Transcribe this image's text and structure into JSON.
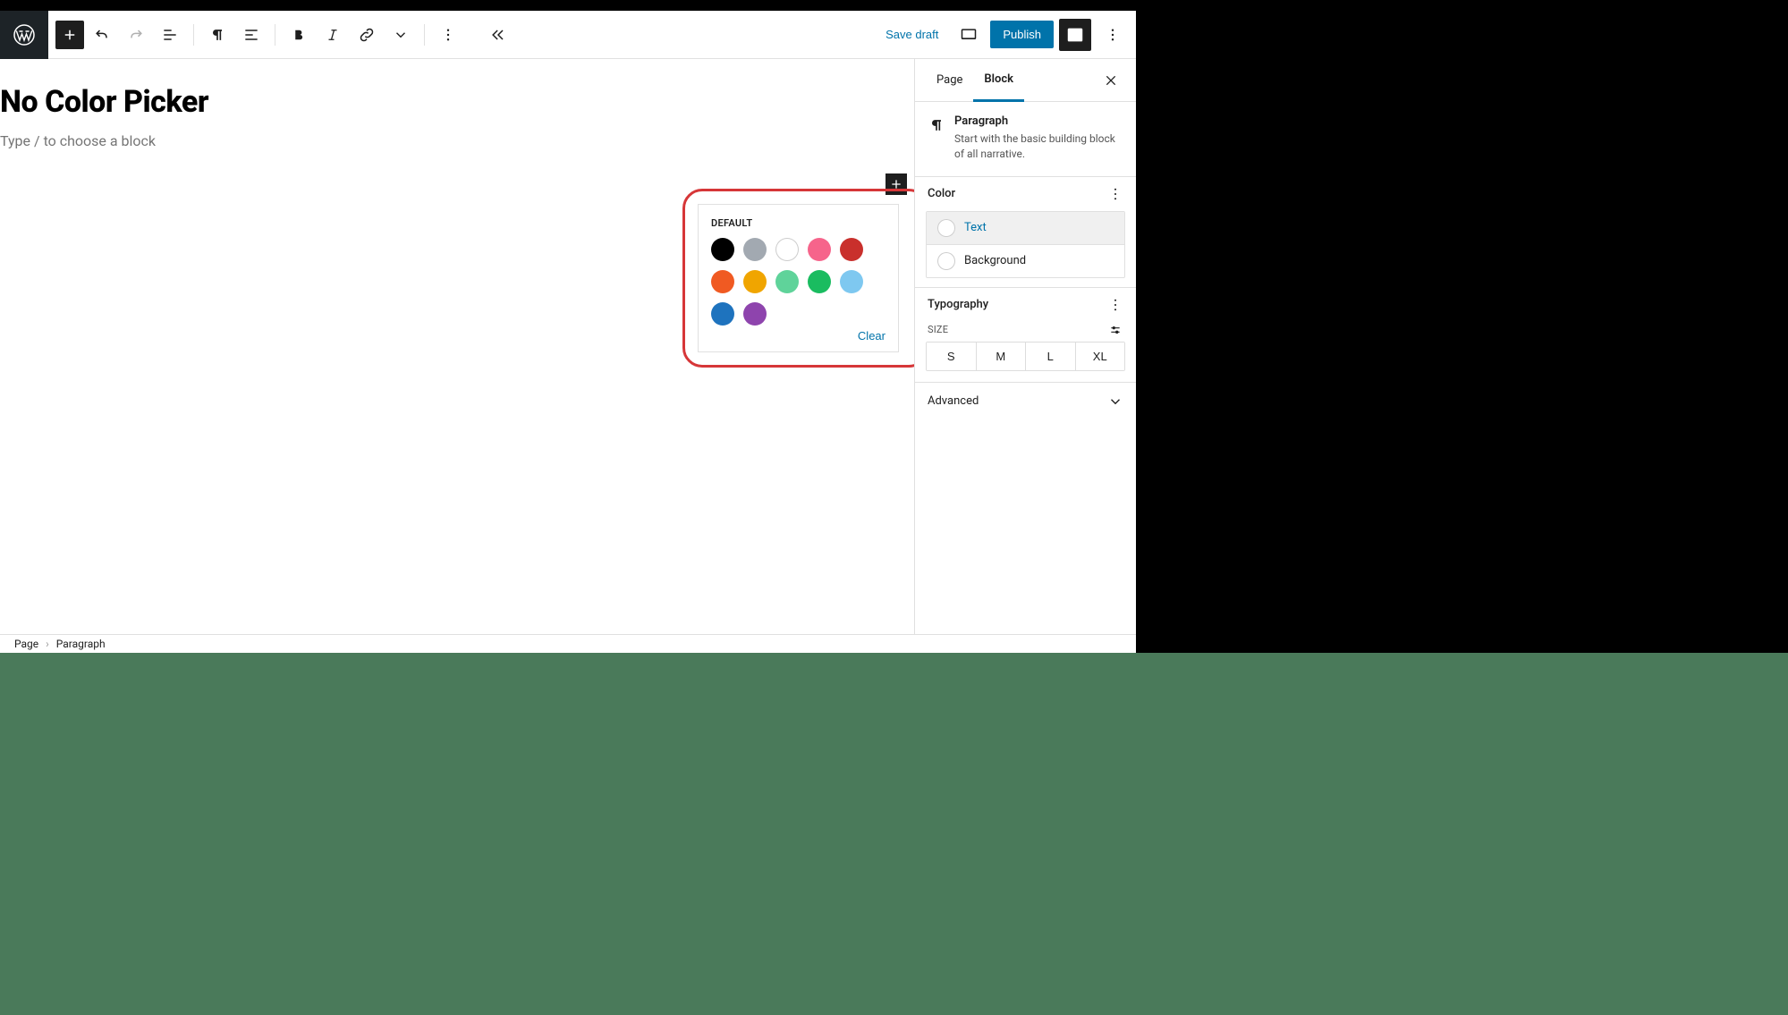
{
  "toolbar": {
    "save_draft": "Save draft",
    "publish": "Publish"
  },
  "page": {
    "title": "No Color Picker",
    "placeholder_text": "Type / to choose a block"
  },
  "color_popover": {
    "label": "DEFAULT",
    "clear": "Clear",
    "swatches": [
      "#000000",
      "#a2a9b1",
      "#ffffff",
      "#f6648b",
      "#c9302c",
      "#f05a22",
      "#f0a500",
      "#5fd39a",
      "#1abc60",
      "#7ec8f0",
      "#1e73be",
      "#8e44ad"
    ]
  },
  "sidebar": {
    "tabs": {
      "page": "Page",
      "block": "Block"
    },
    "block": {
      "name": "Paragraph",
      "desc": "Start with the basic building block of all narrative."
    },
    "color": {
      "heading": "Color",
      "text_row": "Text",
      "bg_row": "Background"
    },
    "typo": {
      "heading": "Typography",
      "size_label": "SIZE",
      "sizes": [
        "S",
        "M",
        "L",
        "XL"
      ]
    },
    "advanced": "Advanced"
  },
  "breadcrumb": {
    "root": "Page",
    "leaf": "Paragraph"
  }
}
